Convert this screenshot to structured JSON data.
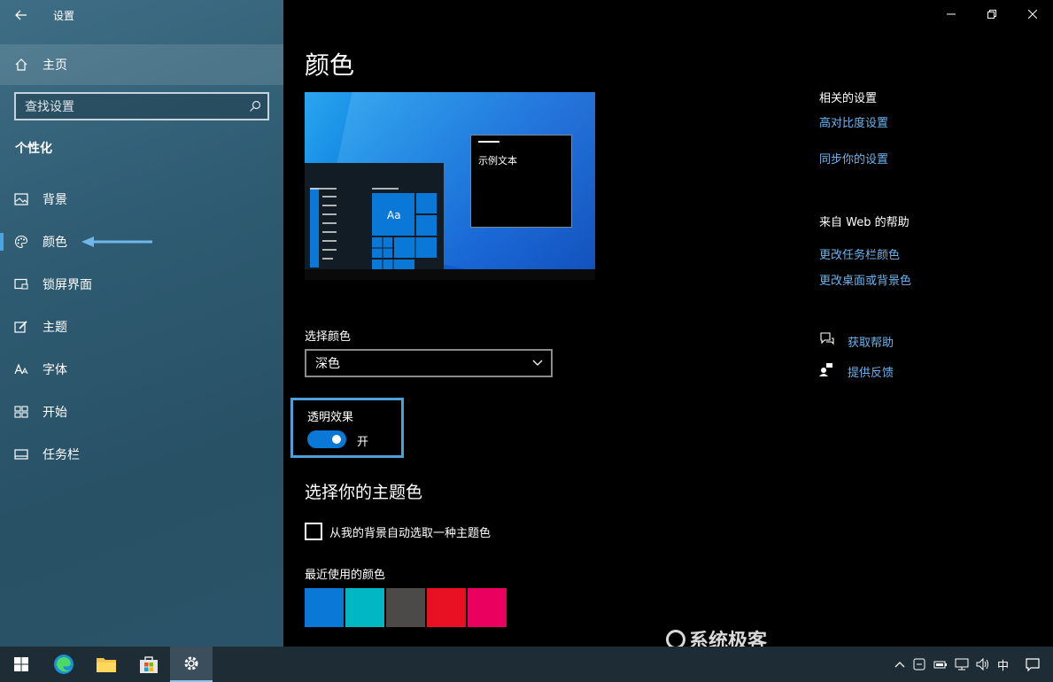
{
  "window": {
    "title": "设置"
  },
  "sidebar": {
    "home_label": "主页",
    "search_placeholder": "查找设置",
    "section_title": "个性化",
    "items": [
      {
        "label": "背景",
        "icon": "picture-icon"
      },
      {
        "label": "颜色",
        "icon": "palette-icon",
        "active": true
      },
      {
        "label": "锁屏界面",
        "icon": "lock-screen-icon"
      },
      {
        "label": "主题",
        "icon": "theme-brush-icon"
      },
      {
        "label": "字体",
        "icon": "font-icon"
      },
      {
        "label": "开始",
        "icon": "start-grid-icon"
      },
      {
        "label": "任务栏",
        "icon": "taskbar-icon"
      }
    ]
  },
  "main": {
    "title": "颜色",
    "preview": {
      "sample_text": "示例文本",
      "tile_text": "Aa"
    },
    "select_color": {
      "label": "选择颜色",
      "value": "深色"
    },
    "transparency": {
      "label": "透明效果",
      "state": "开",
      "on": true
    },
    "accent": {
      "title": "选择你的主题色",
      "auto_pick_label": "从我的背景自动选取一种主题色",
      "recent_label": "最近使用的颜色",
      "recent_colors": [
        "#0a78d7",
        "#00b7c3",
        "#4c4a48",
        "#e81123",
        "#ea005e"
      ]
    }
  },
  "related": {
    "heading": "相关的设置",
    "links": [
      "高对比度设置",
      "同步你的设置"
    ],
    "web_heading": "来自 Web 的帮助",
    "web_links": [
      "更改任务栏颜色",
      "更改桌面或背景色"
    ],
    "get_help": "获取帮助",
    "feedback": "提供反馈"
  },
  "watermark": "系统极客",
  "taskbar": {
    "ime": "中",
    "apps": [
      "windows-start-icon",
      "edge-icon",
      "file-explorer-icon",
      "store-icon",
      "settings-gear-icon"
    ]
  },
  "colors": {
    "accent": "#0a78d7",
    "link": "#69b4f0",
    "highlight_border": "#4f9fd9"
  }
}
